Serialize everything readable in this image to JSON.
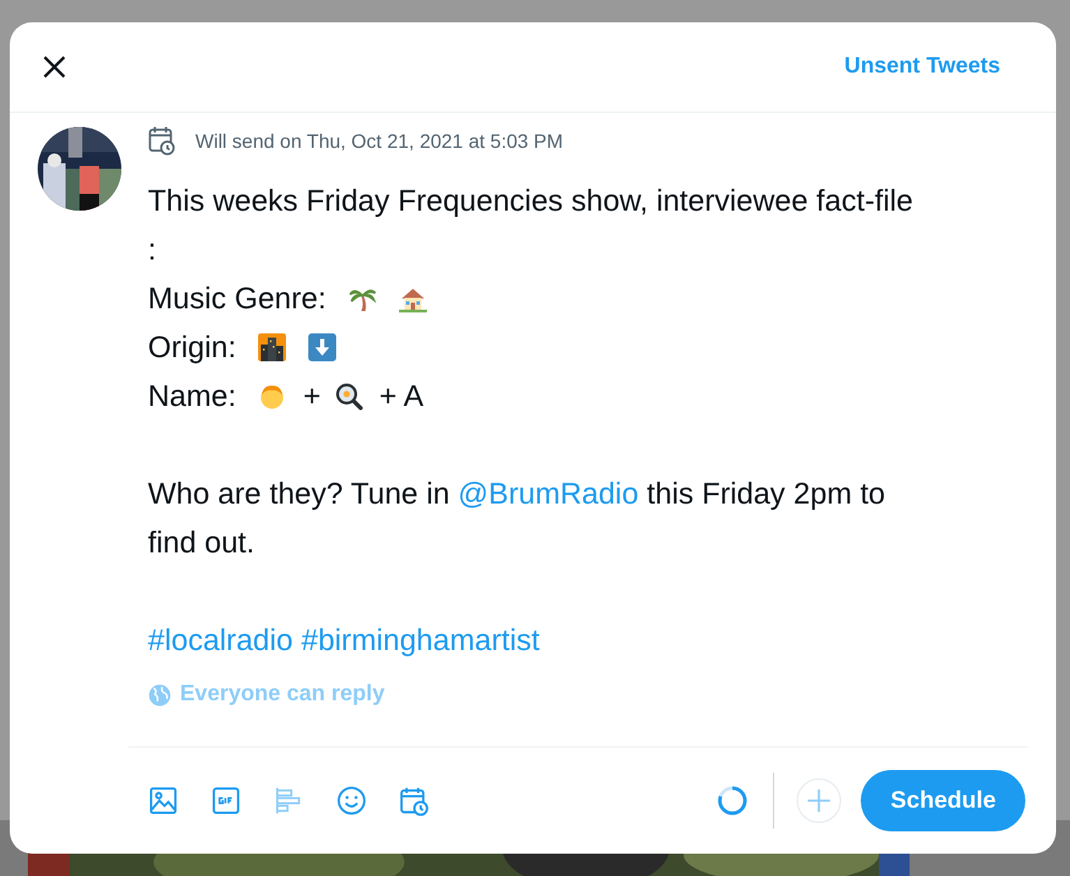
{
  "dialog": {
    "header_link": "Unsent Tweets"
  },
  "schedule_note": "Will send on Thu, Oct 21, 2021 at 5:03 PM",
  "tweet_lines": [
    {
      "parts": [
        {
          "kind": "text",
          "text": "This weeks Friday Frequencies show, interviewee fact-file :"
        }
      ]
    },
    {
      "parts": [
        {
          "kind": "text",
          "text": "Music Genre: "
        },
        {
          "kind": "palm-tree"
        },
        {
          "kind": "house"
        }
      ]
    },
    {
      "parts": [
        {
          "kind": "text",
          "text": "Origin: "
        },
        {
          "kind": "city"
        },
        {
          "kind": "down-arrow"
        }
      ]
    },
    {
      "parts": [
        {
          "kind": "text",
          "text": "Name: "
        },
        {
          "kind": "child"
        },
        {
          "kind": "text",
          "text": "+"
        },
        {
          "kind": "frying-pan"
        },
        {
          "kind": "text",
          "text": "+ A"
        }
      ]
    },
    {
      "parts": [
        {
          "kind": "blank"
        }
      ]
    },
    {
      "parts": [
        {
          "kind": "text",
          "text": "Who are they? Tune in "
        },
        {
          "kind": "mention",
          "text": "@BrumRadio"
        },
        {
          "kind": "text",
          "text": " this Friday 2pm to find out."
        }
      ]
    },
    {
      "parts": [
        {
          "kind": "blank"
        }
      ]
    },
    {
      "parts": [
        {
          "kind": "hashtag",
          "text": "#localradio"
        },
        {
          "kind": "hashtag",
          "text": "#birminghamartist"
        }
      ]
    }
  ],
  "reply_setting": {
    "label": "Everyone can reply",
    "disabled": true
  },
  "toolbar": {
    "button": "Schedule"
  }
}
